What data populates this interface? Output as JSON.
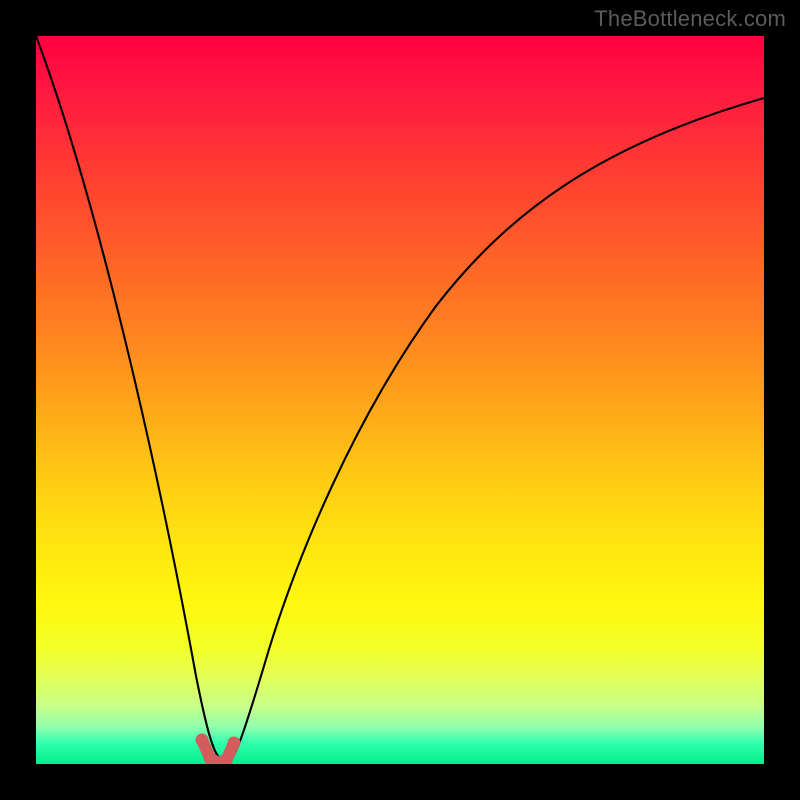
{
  "watermark": "TheBottleneck.com",
  "chart_data": {
    "type": "line",
    "title": "",
    "xlabel": "",
    "ylabel": "",
    "xlim": [
      0,
      100
    ],
    "ylim": [
      0,
      100
    ],
    "series": [
      {
        "name": "curve",
        "x": [
          0,
          4,
          8,
          12,
          16,
          20,
          22,
          24,
          25,
          26,
          28,
          32,
          40,
          50,
          60,
          70,
          80,
          90,
          100
        ],
        "y": [
          100,
          82,
          63,
          44,
          26,
          8,
          2,
          0,
          0,
          0,
          3,
          14,
          35,
          55,
          68,
          77,
          83,
          88,
          91
        ]
      }
    ],
    "markers": {
      "name": "bottom-marker",
      "x_range": [
        22.5,
        27.5
      ],
      "y_range": [
        0,
        3
      ],
      "color": "#d35c5c"
    },
    "gradient_colors": {
      "top": "#ff0040",
      "mid": "#ffe610",
      "bottom": "#00ef8a"
    }
  }
}
